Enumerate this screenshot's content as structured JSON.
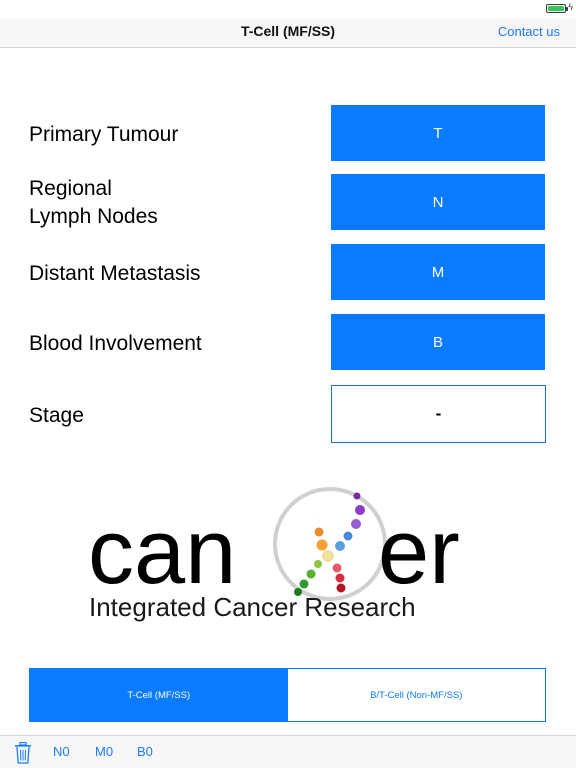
{
  "nav": {
    "title": "T-Cell (MF/SS)",
    "contact": "Contact us"
  },
  "rows": [
    {
      "label": "Primary Tumour",
      "value": "T"
    },
    {
      "label_line1": "Regional",
      "label_line2": "Lymph Nodes",
      "value": "N"
    },
    {
      "label": "Distant Metastasis",
      "value": "M"
    },
    {
      "label": "Blood Involvement",
      "value": "B"
    },
    {
      "label": "Stage",
      "value": "-"
    }
  ],
  "logo": {
    "wordmark_left": "can",
    "wordmark_right": "er",
    "tagline": "Integrated Cancer Research"
  },
  "segments": [
    {
      "label": "T-Cell (MF/SS)",
      "selected": true
    },
    {
      "label": "B/T-Cell (Non-MF/SS)",
      "selected": false
    }
  ],
  "toolbar": {
    "items": [
      "N0",
      "M0",
      "B0"
    ]
  },
  "colors": {
    "accent": "#0a7aff",
    "link": "#1a7bf2"
  }
}
